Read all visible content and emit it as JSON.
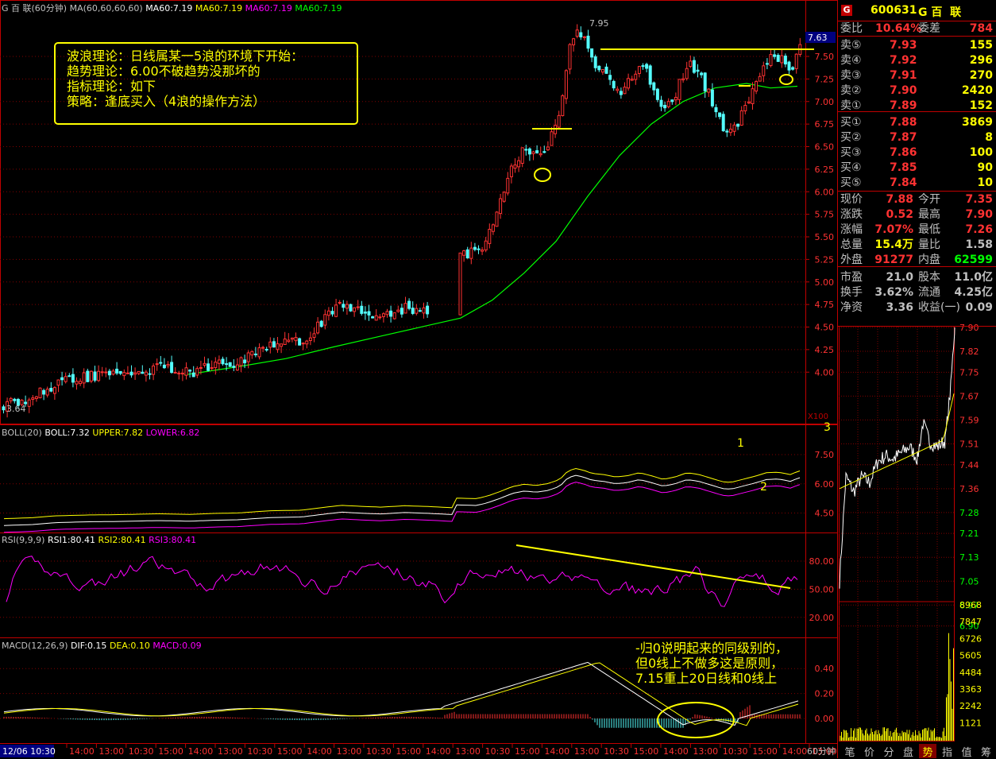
{
  "header": {
    "main_title": "G 百  联(60分钟)",
    "ma_label": "MA(60,60,60,60)",
    "ma_values": [
      "MA60:7.19",
      "MA60:7.19",
      "MA60:7.19",
      "MA60:7.19"
    ],
    "ma_colors": [
      "#ffffff",
      "#ffff00",
      "#ff00ff",
      "#00ff00"
    ]
  },
  "main_chart": {
    "y_ticks": [
      "7.50",
      "7.25",
      "7.00",
      "6.75",
      "6.50",
      "6.25",
      "6.00",
      "5.75",
      "5.50",
      "5.25",
      "5.00",
      "4.75",
      "4.50",
      "4.25",
      "4.00"
    ],
    "high_label": "7.95",
    "low_label": "3.64",
    "current_price_tag": "7.63",
    "scale_label": "X100"
  },
  "annotations": {
    "main_text": [
      "波浪理论：日线属某一5浪的环境下开始：",
      "趋势理论：6.00不破趋势没那坏的",
      "指标理论：如下",
      "策略：逢底买入（4浪的操作方法）"
    ],
    "boll_marks": [
      "1",
      "2",
      "3"
    ],
    "macd_text": [
      "-归0说明起来的同级别的，",
      "但0线上不做多这是原则，",
      "7.15重上20日线和0线上"
    ]
  },
  "boll": {
    "label": "BOLL(20)",
    "value": "BOLL:7.32",
    "upper": "UPPER:7.82",
    "lower": "LOWER:6.82",
    "y_ticks": [
      "7.50",
      "6.00",
      "4.50"
    ]
  },
  "rsi": {
    "label": "RSI(9,9,9)",
    "rsi1": "RSI1:80.41",
    "rsi2": "RSI2:80.41",
    "rsi3": "RSI3:80.41",
    "y_ticks": [
      "80.00",
      "50.00",
      "20.00"
    ]
  },
  "macd": {
    "label": "MACD(12,26,9)",
    "dif": "DIF:0.15",
    "dea": "DEA:0.10",
    "macd": "MACD:0.09",
    "y_ticks": [
      "0.40",
      "0.20",
      "0.00"
    ]
  },
  "x_axis": {
    "date": "12/06 10:30",
    "ticks": [
      "14:00",
      "13:00",
      "10:30",
      "15:00",
      "14:00",
      "13:00",
      "10:30",
      "15:00",
      "14:00",
      "13:00",
      "10:30",
      "15:00",
      "14:00",
      "13:00",
      "10:30",
      "15:00",
      "14:00",
      "13:00",
      "10:30",
      "15:00",
      "14:00",
      "13:00",
      "10:30",
      "15:00",
      "14:00",
      "13:00"
    ],
    "period": "60分钟"
  },
  "quote": {
    "code": "600631",
    "name": "G 百  联",
    "wei_bi_label": "委比",
    "wei_bi": "10.64%",
    "wei_cha_label": "委差",
    "wei_cha": "784",
    "sell": [
      {
        "label": "卖⑤",
        "price": "7.93",
        "vol": "155"
      },
      {
        "label": "卖④",
        "price": "7.92",
        "vol": "296"
      },
      {
        "label": "卖③",
        "price": "7.91",
        "vol": "270"
      },
      {
        "label": "卖②",
        "price": "7.90",
        "vol": "2420"
      },
      {
        "label": "卖①",
        "price": "7.89",
        "vol": "152"
      }
    ],
    "buy": [
      {
        "label": "买①",
        "price": "7.88",
        "vol": "3869"
      },
      {
        "label": "买②",
        "price": "7.87",
        "vol": "8"
      },
      {
        "label": "买③",
        "price": "7.86",
        "vol": "100"
      },
      {
        "label": "买④",
        "price": "7.85",
        "vol": "90"
      },
      {
        "label": "买⑤",
        "price": "7.84",
        "vol": "10"
      }
    ],
    "stats": [
      [
        "现价",
        "7.88",
        "今开",
        "7.35"
      ],
      [
        "涨跌",
        "0.52",
        "最高",
        "7.90"
      ],
      [
        "涨幅",
        "7.07%",
        "最低",
        "7.26"
      ],
      [
        "总量",
        "15.4万",
        "量比",
        "1.58"
      ],
      [
        "外盘",
        "91277",
        "内盘",
        "62599"
      ],
      [
        "市盈",
        "21.0",
        "股本",
        "11.0亿"
      ],
      [
        "换手",
        "3.62%",
        "流通",
        "4.25亿"
      ],
      [
        "净资",
        "3.36",
        "收益(一)",
        "0.09"
      ]
    ]
  },
  "intraday": {
    "price_ticks": [
      "7.90",
      "7.82",
      "7.75",
      "7.67",
      "7.59",
      "7.51",
      "7.44",
      "7.36",
      "7.28",
      "7.21",
      "7.13",
      "7.05",
      "6.97",
      "6.90"
    ],
    "vol_ticks": [
      "8968",
      "7847",
      "6726",
      "5605",
      "4484",
      "3363",
      "2242",
      "1121"
    ]
  },
  "bottom_tabs": [
    "笔",
    "价",
    "分",
    "盘",
    "势",
    "指",
    "值",
    "筹"
  ],
  "colors": {
    "up": "#ff3232",
    "down": "#54fcfc",
    "grid": "#800000",
    "ma": "#00ff00",
    "axis": "#c00000"
  }
}
